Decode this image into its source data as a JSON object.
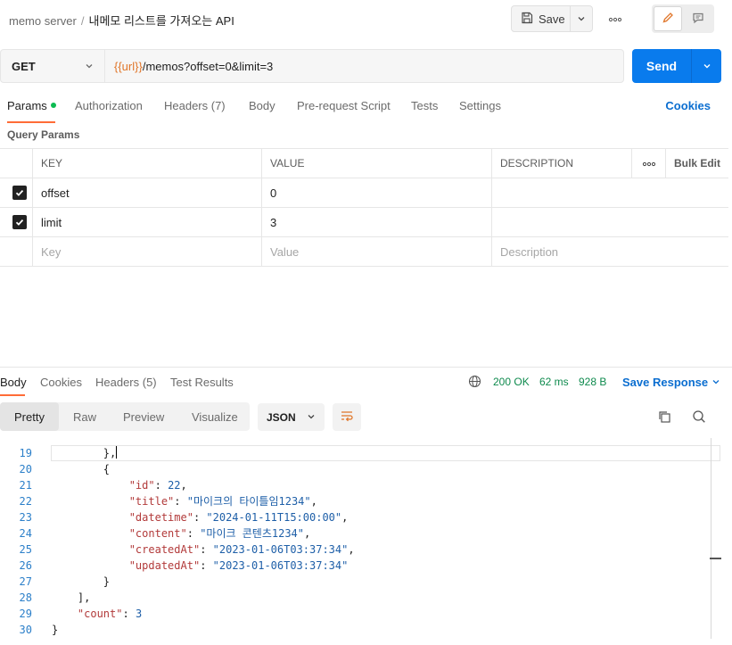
{
  "header": {
    "collection": "memo server",
    "separator": "/",
    "request_name": "내메모 리스트를 가져오는 API",
    "save_label": "Save"
  },
  "request": {
    "method": "GET",
    "url_var": "{{url}}",
    "url_path": "/memos?offset=0&limit=3",
    "send_label": "Send"
  },
  "request_tabs": {
    "params": "Params",
    "authorization": "Authorization",
    "headers": "Headers (7)",
    "body": "Body",
    "prerequest": "Pre-request Script",
    "tests": "Tests",
    "settings": "Settings",
    "cookies": "Cookies"
  },
  "query_params": {
    "title": "Query Params",
    "columns": {
      "key": "KEY",
      "value": "VALUE",
      "description": "DESCRIPTION",
      "bulk_edit": "Bulk Edit"
    },
    "rows": [
      {
        "key": "offset",
        "value": "0",
        "description": ""
      },
      {
        "key": "limit",
        "value": "3",
        "description": ""
      }
    ],
    "placeholders": {
      "key": "Key",
      "value": "Value",
      "description": "Description"
    }
  },
  "response_tabs": {
    "body": "Body",
    "cookies": "Cookies",
    "headers": "Headers (5)",
    "test_results": "Test Results"
  },
  "response_meta": {
    "status": "200 OK",
    "time": "62 ms",
    "size": "928 B",
    "save_response": "Save Response"
  },
  "body_toolbar": {
    "pretty": "Pretty",
    "raw": "Raw",
    "preview": "Preview",
    "visualize": "Visualize",
    "format": "JSON"
  },
  "code": {
    "line_numbers": [
      "19",
      "20",
      "21",
      "22",
      "23",
      "24",
      "25",
      "26",
      "27",
      "28",
      "29",
      "30"
    ],
    "lines": [
      {
        "indent": "        ",
        "parts": [
          {
            "t": "p",
            "v": "},"
          }
        ]
      },
      {
        "indent": "        ",
        "parts": [
          {
            "t": "p",
            "v": "{"
          }
        ]
      },
      {
        "indent": "            ",
        "parts": [
          {
            "t": "k",
            "v": "\"id\""
          },
          {
            "t": "p",
            "v": ": "
          },
          {
            "t": "n",
            "v": "22"
          },
          {
            "t": "p",
            "v": ","
          }
        ]
      },
      {
        "indent": "            ",
        "parts": [
          {
            "t": "k",
            "v": "\"title\""
          },
          {
            "t": "p",
            "v": ": "
          },
          {
            "t": "s",
            "v": "\"마이크의 타이틀임1234\""
          },
          {
            "t": "p",
            "v": ","
          }
        ]
      },
      {
        "indent": "            ",
        "parts": [
          {
            "t": "k",
            "v": "\"datetime\""
          },
          {
            "t": "p",
            "v": ": "
          },
          {
            "t": "s",
            "v": "\"2024-01-11T15:00:00\""
          },
          {
            "t": "p",
            "v": ","
          }
        ]
      },
      {
        "indent": "            ",
        "parts": [
          {
            "t": "k",
            "v": "\"content\""
          },
          {
            "t": "p",
            "v": ": "
          },
          {
            "t": "s",
            "v": "\"마이크 콘텐츠1234\""
          },
          {
            "t": "p",
            "v": ","
          }
        ]
      },
      {
        "indent": "            ",
        "parts": [
          {
            "t": "k",
            "v": "\"createdAt\""
          },
          {
            "t": "p",
            "v": ": "
          },
          {
            "t": "s",
            "v": "\"2023-01-06T03:37:34\""
          },
          {
            "t": "p",
            "v": ","
          }
        ]
      },
      {
        "indent": "            ",
        "parts": [
          {
            "t": "k",
            "v": "\"updatedAt\""
          },
          {
            "t": "p",
            "v": ": "
          },
          {
            "t": "s",
            "v": "\"2023-01-06T03:37:34\""
          }
        ]
      },
      {
        "indent": "        ",
        "parts": [
          {
            "t": "p",
            "v": "}"
          }
        ]
      },
      {
        "indent": "    ",
        "parts": [
          {
            "t": "p",
            "v": "],"
          }
        ]
      },
      {
        "indent": "    ",
        "parts": [
          {
            "t": "k",
            "v": "\"count\""
          },
          {
            "t": "p",
            "v": ": "
          },
          {
            "t": "n",
            "v": "3"
          }
        ]
      },
      {
        "indent": "",
        "parts": [
          {
            "t": "p",
            "v": "}"
          }
        ]
      }
    ]
  },
  "colors": {
    "accent": "#ff6c37",
    "send": "#097bed",
    "link": "#0b6ed0",
    "status_ok": "#0e8a4d",
    "url_var": "#e0762a"
  },
  "icons": [
    "save-icon",
    "chevron-down-icon",
    "more-horizontal-icon",
    "edit-icon",
    "comment-icon",
    "check-icon",
    "globe-icon",
    "wrap-lines-icon",
    "copy-icon",
    "search-icon"
  ]
}
